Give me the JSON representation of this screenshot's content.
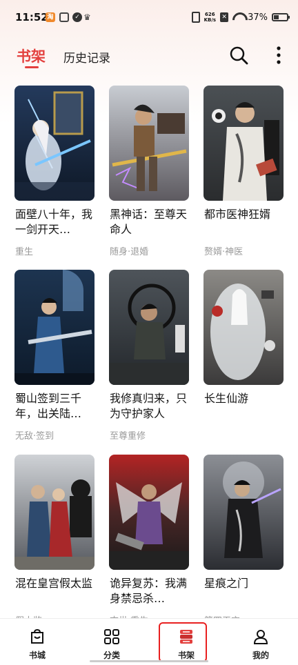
{
  "status_bar": {
    "time": "11:52",
    "net_speed_value": "626",
    "net_speed_unit": "KB/s",
    "battery_percent": "37%",
    "battery_level": 0.37
  },
  "header": {
    "tabs": [
      {
        "label": "书架",
        "active": true
      },
      {
        "label": "历史记录",
        "active": false
      }
    ],
    "search_icon": "search-icon",
    "more_icon": "more-vertical-icon"
  },
  "books": [
    {
      "title": "面壁八十年，我一剑开天…",
      "tags": "重生"
    },
    {
      "title": "黑神话：至尊天命人",
      "tags": "随身·退婚"
    },
    {
      "title": "都市医神狂婿",
      "tags": "赘婿·神医"
    },
    {
      "title": "蜀山签到三千年，出关陆…",
      "tags": "无敌·签到"
    },
    {
      "title": "我修真归来，只为守护家人",
      "tags": "至尊重修"
    },
    {
      "title": "长生仙游",
      "tags": ""
    },
    {
      "title": "混在皇宫假太监",
      "tags": "假太监"
    },
    {
      "title": "诡异复苏：我满身禁忌杀…",
      "tags": "末世·重生"
    },
    {
      "title": "星痕之门",
      "tags": "第四天灾"
    }
  ],
  "bottom_nav": [
    {
      "label": "书城",
      "icon": "bookstore-icon"
    },
    {
      "label": "分类",
      "icon": "category-grid-icon"
    },
    {
      "label": "书架",
      "icon": "bookshelf-icon",
      "active": true
    },
    {
      "label": "我的",
      "icon": "profile-icon"
    }
  ],
  "colors": {
    "accent": "#e3403e",
    "highlight_box": "#e81f1f"
  }
}
